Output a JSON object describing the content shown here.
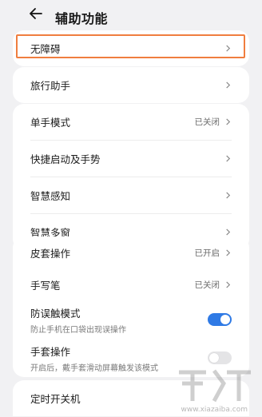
{
  "header": {
    "title": "辅助功能"
  },
  "group1": [
    {
      "label": "无障碍"
    }
  ],
  "group2": [
    {
      "label": "旅行助手"
    }
  ],
  "group3": [
    {
      "label": "单手模式",
      "value": "已关闭"
    },
    {
      "label": "快捷启动及手势"
    },
    {
      "label": "智慧感知"
    },
    {
      "label": "智慧多窗"
    }
  ],
  "group4": [
    {
      "label": "皮套操作",
      "value": "已开启"
    },
    {
      "label": "手写笔",
      "value": "已关闭"
    },
    {
      "label": "防误触模式",
      "sub": "防止手机在口袋出现误操作",
      "toggle": "on"
    },
    {
      "label": "手套操作",
      "sub": "开启后，戴手套滑动屏幕触发该模式",
      "toggle": "off"
    }
  ],
  "group5": [
    {
      "label": "定时开关机"
    }
  ],
  "colors": {
    "highlight": "#f07e3f",
    "toggle_on": "#2f7ae5"
  },
  "watermark": {
    "url": "www.xiazaiba.com"
  }
}
